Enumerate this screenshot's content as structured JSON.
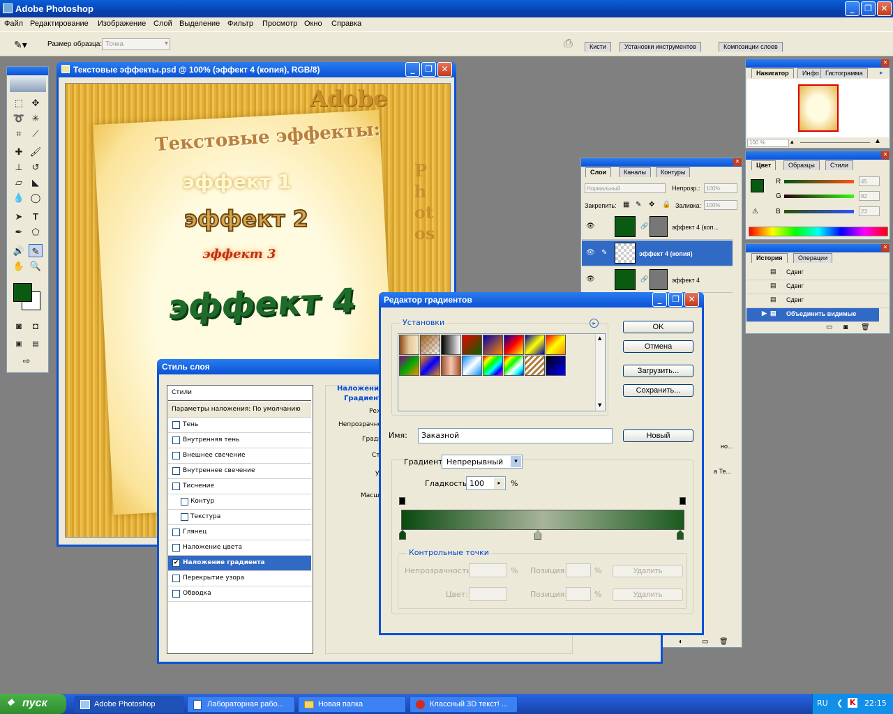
{
  "app": {
    "title": "Adobe Photoshop"
  },
  "menu": [
    "Файл",
    "Редактирование",
    "Изображение",
    "Слой",
    "Выделение",
    "Фильтр",
    "Просмотр",
    "Окно",
    "Справка"
  ],
  "options": {
    "sample_size_label": "Размер образца:",
    "sample_size_value": "Точка",
    "tabs": [
      "Кисти",
      "Установки инструментов",
      "Композиции слоев"
    ]
  },
  "document": {
    "title": "Текстовые эффекты.psd @ 100% (эффект 4 (копия), RGB/8)",
    "canvas_text": {
      "adobe": "Adobe",
      "heading": "Текстовые эффекты:",
      "e1": "эффект 1",
      "e2": "эффект 2",
      "e3": "эффект 3",
      "e4": "эффект 4",
      "photoshop": "Photos"
    }
  },
  "navigator": {
    "tabs": [
      "Навигатор",
      "Инфо",
      "Гистограмма"
    ],
    "zoom": "100 %"
  },
  "color": {
    "tabs": [
      "Цвет",
      "Образцы",
      "Стили"
    ],
    "r_label": "R",
    "g_label": "G",
    "b_label": "B",
    "r": "45",
    "g": "82",
    "b": "23",
    "fg": "#0b5a12"
  },
  "layers": {
    "tabs": [
      "Слои",
      "Каналы",
      "Контуры"
    ],
    "blend": "Нормальный",
    "opacity_label": "Непрозр.:",
    "opacity": "100%",
    "lock_label": "Закрепить:",
    "fill_label": "Заливка:",
    "fill": "100%",
    "items": [
      "эффект 4 (коп...",
      "эффект 4 (копия)",
      "эффект 4"
    ],
    "partial": [
      "но...",
      "а Те..."
    ]
  },
  "history": {
    "tabs": [
      "История",
      "Операции"
    ],
    "items": [
      "Сдвиг",
      "Сдвиг",
      "Сдвиг",
      "Объединить видимые"
    ]
  },
  "layer_style": {
    "title": "Стиль слоя",
    "header": "Стили",
    "rows": [
      "Параметры наложения: По умолчанию",
      "Тень",
      "Внутренняя тень",
      "Внешнее свечение",
      "Внутреннее свечение",
      "Тиснение",
      "Контур",
      "Текстура",
      "Глянец",
      "Наложение цвета",
      "Наложение градиента",
      "Перекрытие узора",
      "Обводка"
    ],
    "right_title": "Наложение",
    "right_sub": "Градиент",
    "right_labels": [
      "Реж",
      "Непрозрачно",
      "Гради",
      "Ст",
      "У",
      "Масш"
    ]
  },
  "gradient_editor": {
    "title": "Редактор градиентов",
    "presets_label": "Установки",
    "ok": "OK",
    "cancel": "Отмена",
    "load": "Загрузить...",
    "save": "Сохранить...",
    "name_label": "Имя:",
    "name_value": "Заказной",
    "new": "Новый",
    "type_label": "Градиент:",
    "type_value": "Непрерывный",
    "smooth_label": "Гладкость:",
    "smooth_value": "100",
    "percent": "%",
    "stops_label": "Контрольные точки",
    "opacity_label": "Непрозрачность:",
    "position_label": "Позиция:",
    "color_label": "Цвет:",
    "delete": "Удалить",
    "gradient_colors": [
      "#0b4a0f",
      "#a7b49a",
      "#1c5a1f"
    ]
  },
  "taskbar": {
    "start": "пуск",
    "items": [
      "Adobe Photoshop",
      "Лабораторная рабо...",
      "Новая папка",
      "Классный 3D текст! ..."
    ],
    "lang": "RU",
    "time": "22:15"
  }
}
